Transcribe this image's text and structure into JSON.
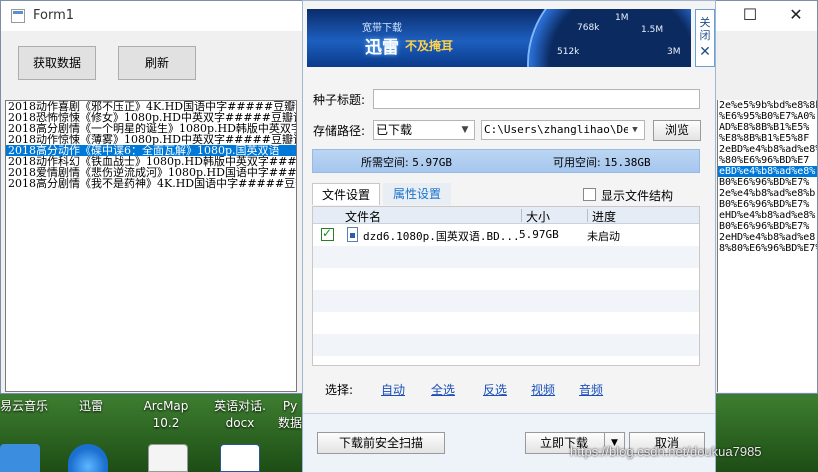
{
  "form1": {
    "title": "Form1",
    "btn_fetch": "获取数据",
    "btn_refresh": "刷新",
    "list_items": [
      "2018动作喜剧《邪不压正》4K.HD国语中字#####豆瓣评分：",
      "2018恐怖惊悚《修女》1080p.HD中英双字#####豆瓣评分：",
      "2018高分剧情《一个明星的诞生》1080p.HD韩版中英双字",
      "2018动作惊悚《薄雾》1080p.HD中英双字#####豆瓣评分",
      "2018高分动作《碟中谍6：全面瓦解》1080p.国英双语",
      "2018动作科幻《铁血战士》1080p.HD韩版中英双字####",
      "2018爱情剧情《悲伤逆流成河》1080p.HD国语中字####",
      "2018高分剧情《我不是药神》4K.HD国语中字#####豆瓣"
    ],
    "selected_index": 4,
    "right_items": [
      "2e%e5%9b%bd%e8%8b",
      "%E6%95%B0%E7%A0%",
      "AD%E8%8B%B1%E5%",
      "%E8%8B%B1%E5%8F",
      "2eBD%e4%b8%ad%e8%",
      "%80%E6%96%BD%E7",
      "eBD%e4%b8%ad%e8%",
      "B0%E6%96%BD%E7%",
      "2e%e4%b8%ad%e8%b",
      "B0%E6%96%BD%E7%",
      "eHD%e4%b8%ad%e8%",
      "B0%E6%96%BD%E7%",
      "2eHD%e4%b8%ad%e8",
      "8%80%E6%96%BD%E7%4"
    ]
  },
  "dialog": {
    "banner_sub": "宽带下载",
    "banner_brand": "迅雷",
    "banner_brand2": "不及掩耳",
    "gauge_labels": [
      "768k",
      "1M",
      "1.5M",
      "512k",
      "3M"
    ],
    "close_tab": "关闭",
    "torrent_title_label": "种子标题:",
    "torrent_title_value": "",
    "save_path_label": "存储路径:",
    "save_path_combo": "已下载",
    "save_path_value": "C:\\Users\\zhanglihao\\Des",
    "browse": "浏览",
    "required_space_label": "所需空间:",
    "required_space_value": "5.97GB",
    "available_space_label": "可用空间:",
    "available_space_value": "15.38GB",
    "tab_file": "文件设置",
    "tab_props": "属性设置",
    "show_structure": "显示文件结构",
    "col_name": "文件名",
    "col_size": "大小",
    "col_progress": "进度",
    "files": [
      {
        "name": "dzd6.1080p.国英双语.BD...",
        "size": "5.97GB",
        "progress": "未启动",
        "checked": true
      }
    ],
    "select_label": "选择:",
    "sel_auto": "自动",
    "sel_all": "全选",
    "sel_invert": "反选",
    "sel_video": "视频",
    "sel_audio": "音频",
    "btn_scan": "下载前安全扫描",
    "btn_download": "立即下载",
    "btn_cancel": "取消"
  },
  "desktop": {
    "labels": [
      {
        "text": "易云音乐"
      },
      {
        "text": "迅雷"
      },
      {
        "text": "ArcMap\n10.2"
      },
      {
        "text": "英语对话.\ndocx"
      },
      {
        "text": "Py\n数据"
      }
    ],
    "watermark": "https://blog.csdn.net/doukua7985"
  },
  "colors": {
    "selection": "#0078d7",
    "link": "#1a4fb8",
    "space_bar": "#a5c6ee"
  }
}
